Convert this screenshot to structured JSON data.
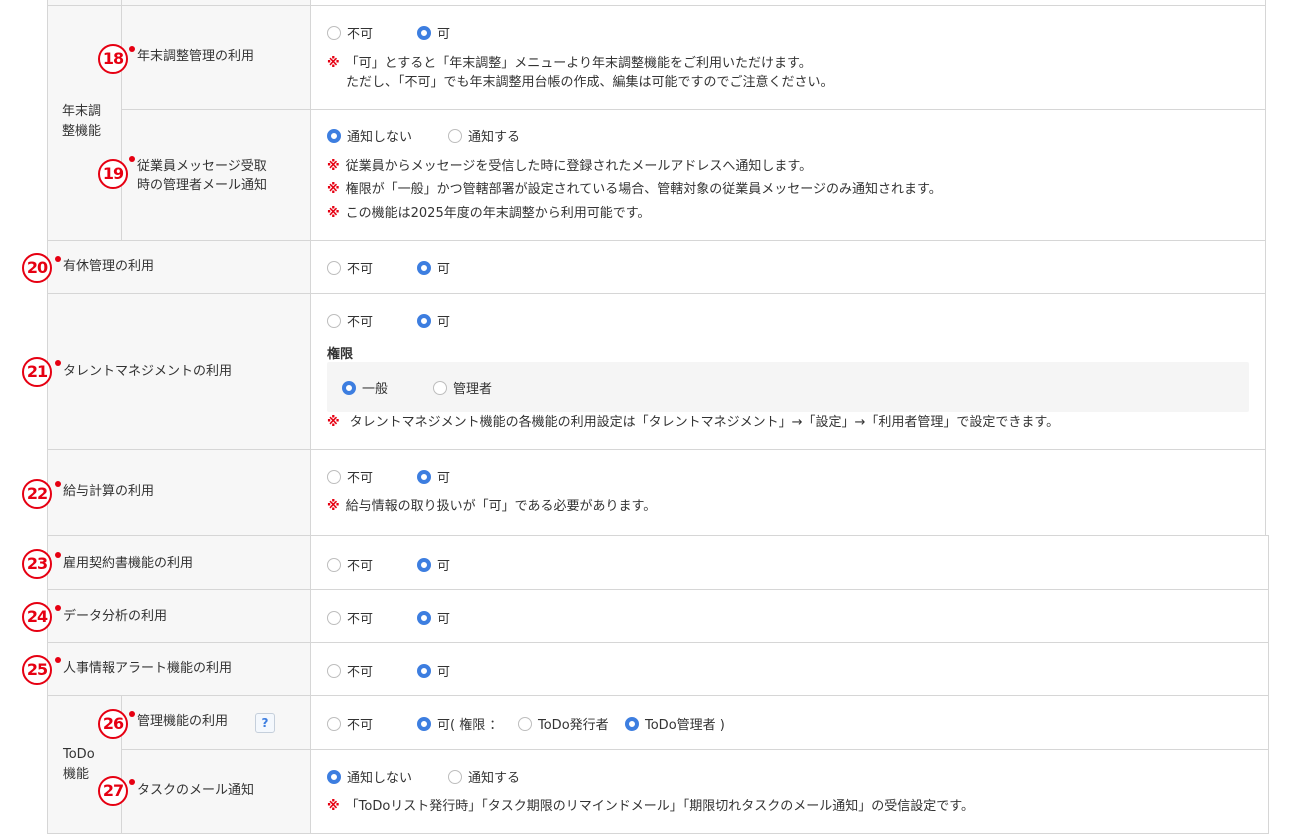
{
  "group_year_end": "年末調整機能",
  "group_todo": "ToDo機能",
  "opt_no": "不可",
  "opt_yes": "可",
  "opt_notify_no": "通知しない",
  "opt_notify_yes": "通知する",
  "note_mark": "※",
  "rows": {
    "r18": {
      "num": "18",
      "label": "年末調整管理の利用",
      "note1": "「可」とすると「年末調整」メニューより年末調整機能をご利用いただけます。",
      "note2": "ただし、「不可」でも年末調整用台帳の作成、編集は可能ですのでご注意ください。",
      "selected": "yes"
    },
    "r19": {
      "num": "19",
      "label1": "従業員メッセージ受取",
      "label2": "時の管理者メール通知",
      "note1": "従業員からメッセージを受信した時に登録されたメールアドレスへ通知します。",
      "note2": "権限が「一般」かつ管轄部署が設定されている場合、管轄対象の従業員メッセージのみ通知されます。",
      "note3": "この機能は2025年度の年末調整から利用可能です。",
      "selected": "notify_no"
    },
    "r20": {
      "num": "20",
      "label": "有休管理の利用",
      "selected": "yes"
    },
    "r21": {
      "num": "21",
      "label": "タレントマネジメントの利用",
      "subtitle": "権限",
      "perm_general": "一般",
      "perm_admin": "管理者",
      "note": "タレントマネジメント機能の各機能の利用設定は「タレントマネジメント」→「設定」→「利用者管理」で設定できます。",
      "selected": "yes",
      "perm_selected": "general"
    },
    "r22": {
      "num": "22",
      "label": "給与計算の利用",
      "note": "給与情報の取り扱いが「可」である必要があります。",
      "selected": "yes"
    },
    "r23": {
      "num": "23",
      "label": "雇用契約書機能の利用",
      "selected": "yes"
    },
    "r24": {
      "num": "24",
      "label": "データ分析の利用",
      "selected": "yes"
    },
    "r25": {
      "num": "25",
      "label": "人事情報アラート機能の利用",
      "selected": "yes"
    },
    "r26": {
      "num": "26",
      "label": "管理機能の利用",
      "help": "?",
      "yes_prefix": "可( 権限 ：",
      "role_issuer": "ToDo発行者",
      "role_admin": "ToDo管理者 )",
      "selected": "yes",
      "role_selected": "admin"
    },
    "r27": {
      "num": "27",
      "label": "タスクのメール通知",
      "note": "「ToDoリスト発行時」「タスク期限のリマインドメール」「期限切れタスクのメール通知」の受信設定です。",
      "selected": "notify_no"
    }
  },
  "colors": {
    "accent": "#3d7ee0",
    "mark": "#e60012",
    "border": "#d6d6d6",
    "label_bg": "#f7f7f7"
  }
}
